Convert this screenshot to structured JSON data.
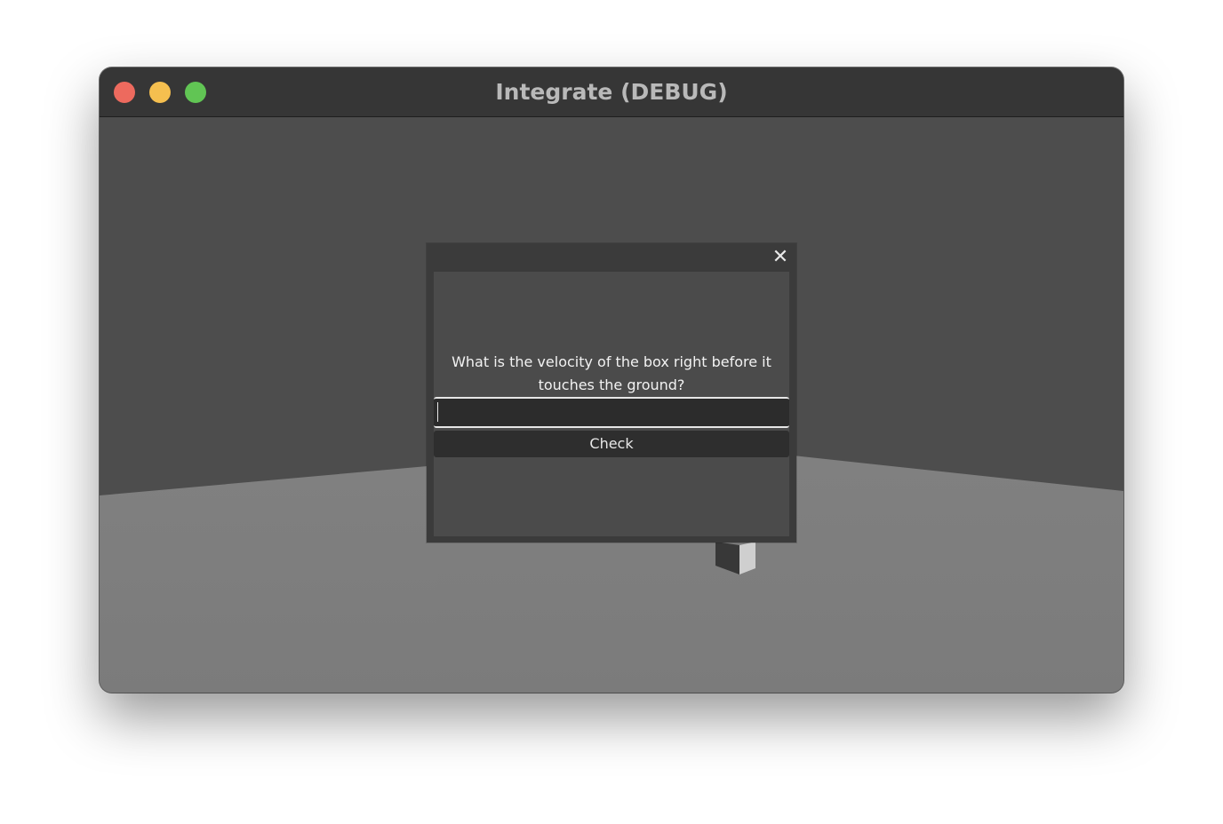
{
  "window": {
    "title": "Integrate (DEBUG)"
  },
  "dialog": {
    "close_glyph": "✕",
    "question": "What is the velocity of the box right before it touches the ground?",
    "input_value": "",
    "check_label": "Check"
  },
  "colors": {
    "titlebar": "#363636",
    "wall": "#4d4d4d",
    "floor": "#7f7f7f",
    "close_button": "#ed6a5e",
    "minimize_button": "#f5bf4f",
    "maximize_button": "#61c554"
  }
}
